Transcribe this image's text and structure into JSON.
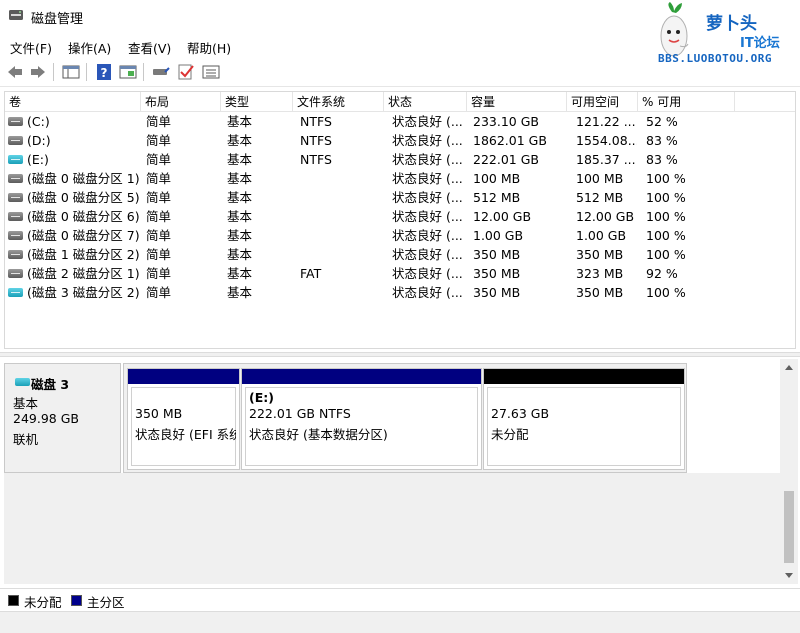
{
  "window": {
    "title": "磁盘管理"
  },
  "watermark": {
    "brand": "萝卜头",
    "sub": "IT论坛",
    "url": "BBS.LUOBOTOU.ORG"
  },
  "menu": [
    "文件(F)",
    "操作(A)",
    "查看(V)",
    "帮助(H)"
  ],
  "toolbar": {
    "buttons": [
      "back-arrow-icon",
      "forward-arrow-icon",
      "console-tree-icon",
      "help-icon",
      "properties-icon",
      "connect-drive-icon",
      "check-icon",
      "list-view-icon"
    ]
  },
  "volumes": {
    "columns": [
      "卷",
      "布局",
      "类型",
      "文件系统",
      "状态",
      "容量",
      "可用空间",
      "% 可用"
    ],
    "rows": [
      {
        "icon": "gray",
        "name": "(C:)",
        "layout": "简单",
        "type": "基本",
        "fs": "NTFS",
        "status": "状态良好 (...",
        "capacity": "233.10 GB",
        "free": "121.22 ...",
        "pct": "52 %"
      },
      {
        "icon": "gray",
        "name": "(D:)",
        "layout": "简单",
        "type": "基本",
        "fs": "NTFS",
        "status": "状态良好 (...",
        "capacity": "1862.01 GB",
        "free": "1554.08...",
        "pct": "83 %"
      },
      {
        "icon": "cyan",
        "name": "(E:)",
        "layout": "简单",
        "type": "基本",
        "fs": "NTFS",
        "status": "状态良好 (...",
        "capacity": "222.01 GB",
        "free": "185.37 ...",
        "pct": "83 %"
      },
      {
        "icon": "gray",
        "name": "(磁盘 0 磁盘分区 1)",
        "layout": "简单",
        "type": "基本",
        "fs": "",
        "status": "状态良好 (...",
        "capacity": "100 MB",
        "free": "100 MB",
        "pct": "100 %"
      },
      {
        "icon": "gray",
        "name": "(磁盘 0 磁盘分区 5)",
        "layout": "简单",
        "type": "基本",
        "fs": "",
        "status": "状态良好 (...",
        "capacity": "512 MB",
        "free": "512 MB",
        "pct": "100 %"
      },
      {
        "icon": "gray",
        "name": "(磁盘 0 磁盘分区 6)",
        "layout": "简单",
        "type": "基本",
        "fs": "",
        "status": "状态良好 (...",
        "capacity": "12.00 GB",
        "free": "12.00 GB",
        "pct": "100 %"
      },
      {
        "icon": "gray",
        "name": "(磁盘 0 磁盘分区 7)",
        "layout": "简单",
        "type": "基本",
        "fs": "",
        "status": "状态良好 (...",
        "capacity": "1.00 GB",
        "free": "1.00 GB",
        "pct": "100 %"
      },
      {
        "icon": "gray",
        "name": "(磁盘 1 磁盘分区 2)",
        "layout": "简单",
        "type": "基本",
        "fs": "",
        "status": "状态良好 (...",
        "capacity": "350 MB",
        "free": "350 MB",
        "pct": "100 %"
      },
      {
        "icon": "gray",
        "name": "(磁盘 2 磁盘分区 1)",
        "layout": "简单",
        "type": "基本",
        "fs": "FAT",
        "status": "状态良好 (...",
        "capacity": "350 MB",
        "free": "323 MB",
        "pct": "92 %"
      },
      {
        "icon": "cyan",
        "name": "(磁盘 3 磁盘分区 2)",
        "layout": "简单",
        "type": "基本",
        "fs": "",
        "status": "状态良好 (...",
        "capacity": "350 MB",
        "free": "350 MB",
        "pct": "100 %"
      }
    ]
  },
  "disk": {
    "name": "磁盘 3",
    "type": "基本",
    "size": "249.98 GB",
    "state": "联机",
    "partitions": [
      {
        "label": "",
        "line1": "350 MB",
        "line2": "状态良好 (EFI 系统",
        "bar": "primary"
      },
      {
        "label": "(E:)",
        "line1": "222.01 GB NTFS",
        "line2": "状态良好 (基本数据分区)",
        "bar": "primary"
      },
      {
        "label": "",
        "line1": "27.63 GB",
        "line2": "未分配",
        "bar": "unallocated"
      }
    ]
  },
  "legend": [
    {
      "label": "未分配",
      "color": "#000000"
    },
    {
      "label": "主分区",
      "color": "#00008b"
    }
  ],
  "colors": {
    "primary": "#000080",
    "unallocated": "#000000"
  }
}
